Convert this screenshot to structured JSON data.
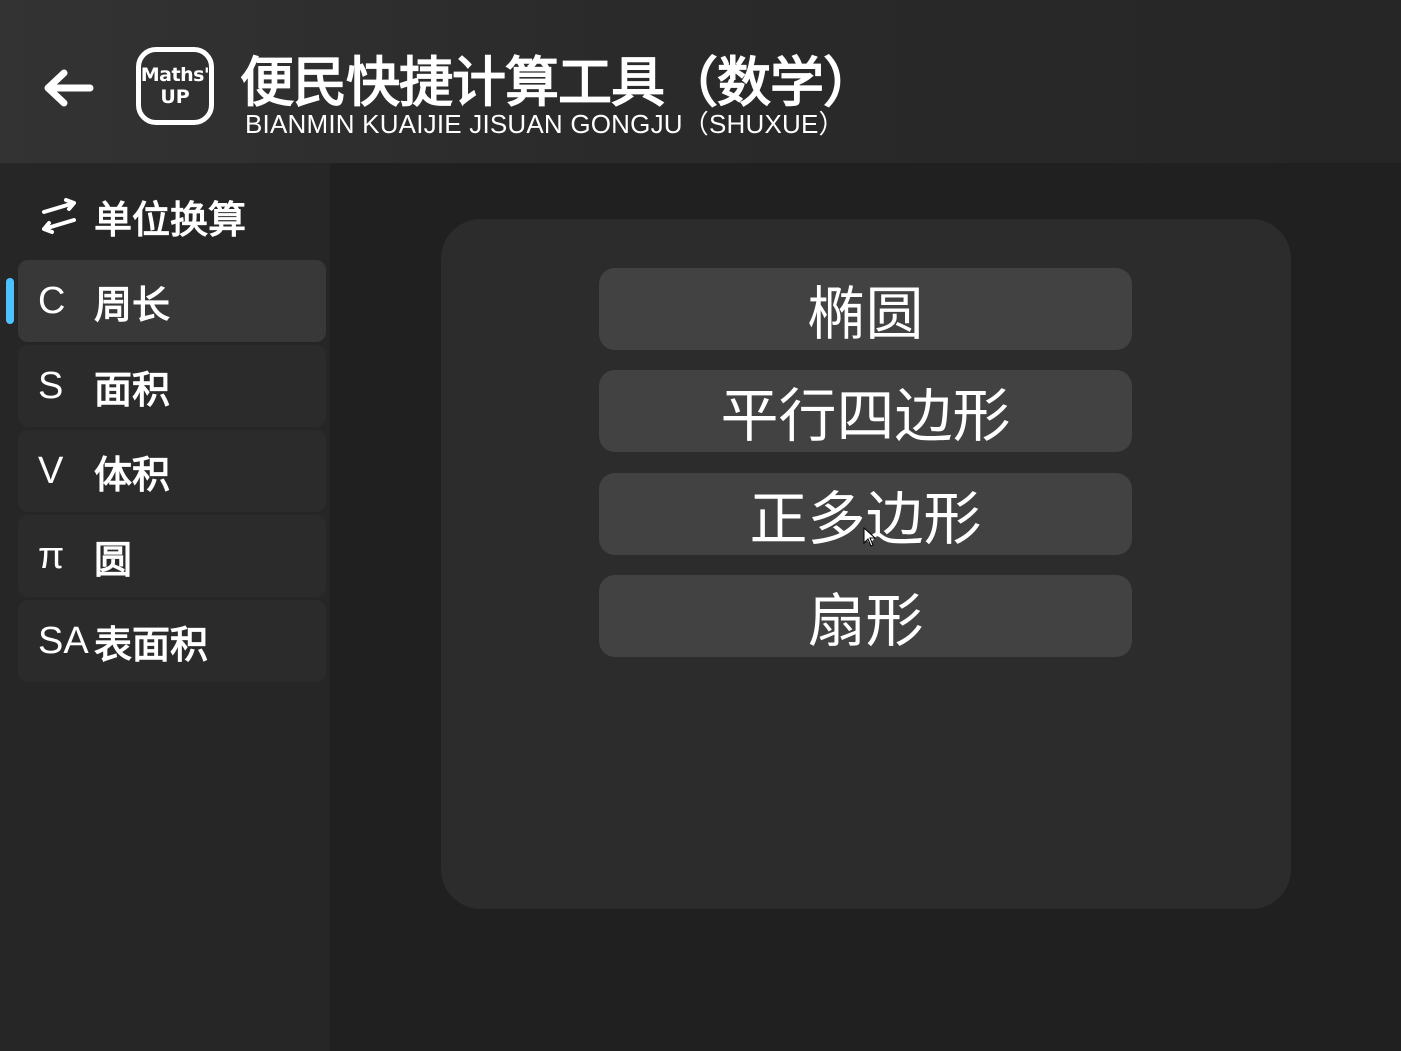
{
  "header": {
    "title": "便民快捷计算工具（数学）",
    "subtitle": "BIANMIN KUAIJIE JISUAN GONGJU（SHUXUE）",
    "logo_line1": "Maths'",
    "logo_line2": "UP"
  },
  "sidebar": {
    "heading": "单位换算",
    "items": [
      {
        "symbol": "C",
        "label": "周长",
        "active": true
      },
      {
        "symbol": "S",
        "label": "面积",
        "active": false
      },
      {
        "symbol": "V",
        "label": "体积",
        "active": false
      },
      {
        "symbol": "π",
        "label": "圆",
        "active": false
      },
      {
        "symbol": "SA",
        "label": "表面积",
        "active": false
      }
    ]
  },
  "main": {
    "buttons": [
      "椭圆",
      "平行四边形",
      "正多边形",
      "扇形"
    ]
  },
  "colors": {
    "accent": "#4cc2ff",
    "background": "#202020",
    "panel": "#2c2c2c",
    "button": "#424242"
  }
}
